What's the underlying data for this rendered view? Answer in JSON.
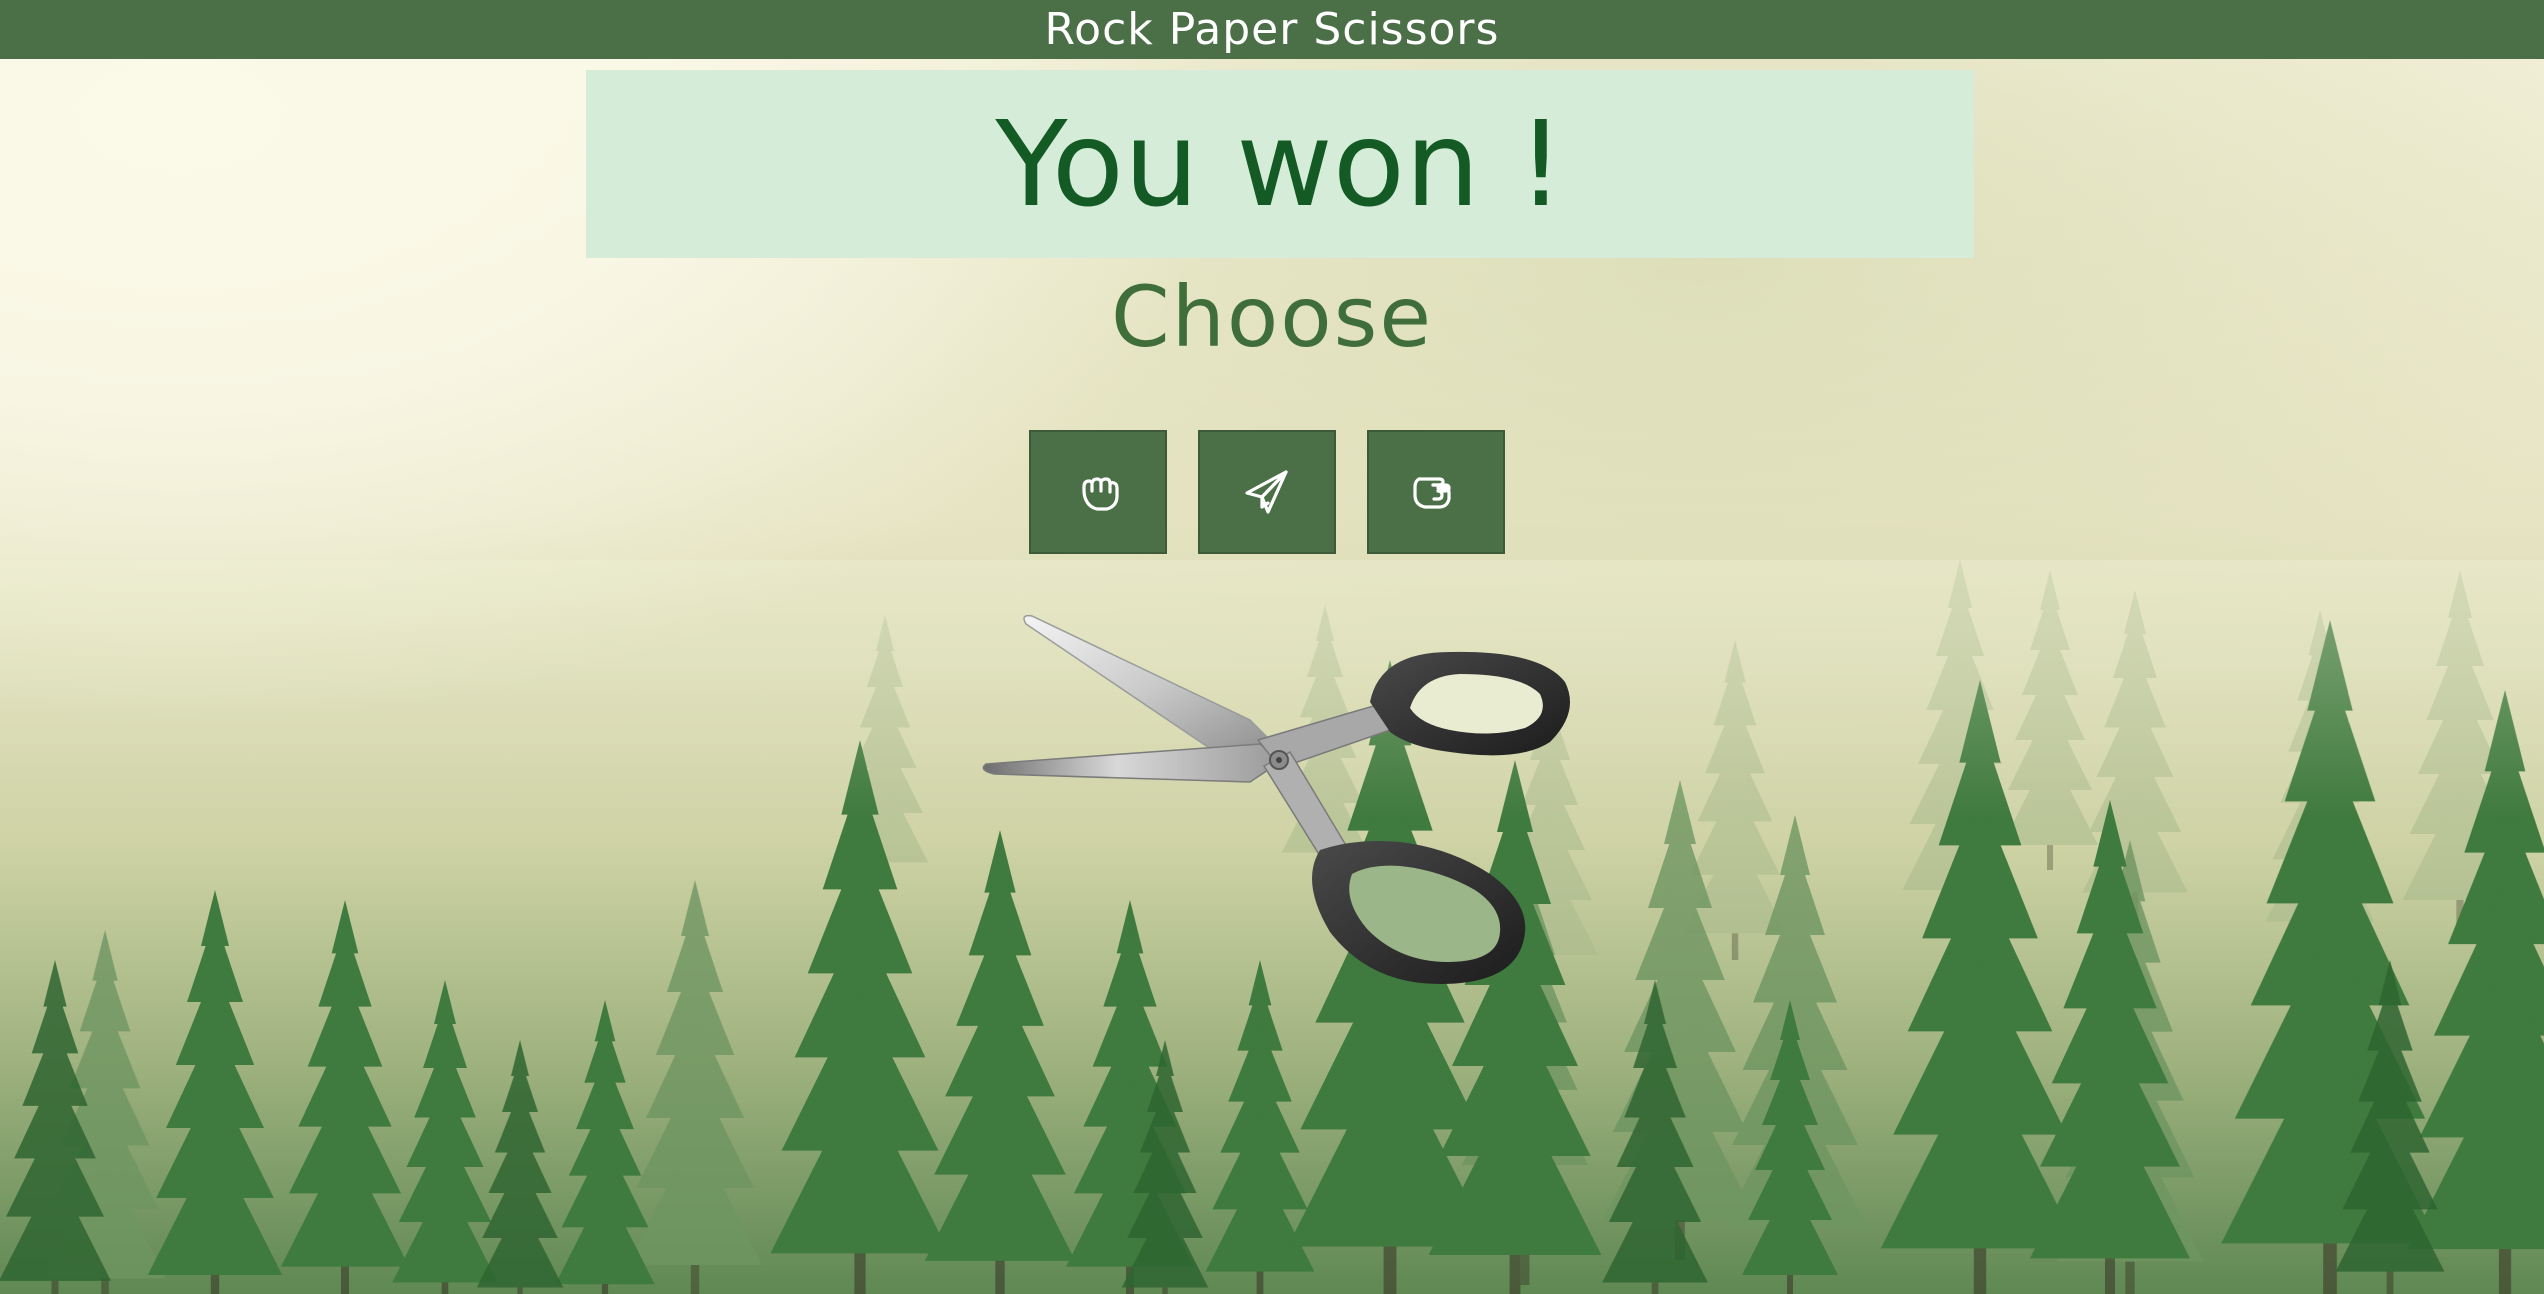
{
  "header": {
    "title": "Rock Paper Scissors"
  },
  "result": {
    "text": "You won !"
  },
  "choose": {
    "label": "Choose"
  },
  "choices": [
    {
      "name": "rock",
      "icon": "hand-fist-icon"
    },
    {
      "name": "paper",
      "icon": "paper-plane-icon"
    },
    {
      "name": "scissors",
      "icon": "hand-scissors-icon"
    }
  ],
  "computer_choice": {
    "icon": "scissors-icon"
  },
  "colors": {
    "header_bg": "#4b7047",
    "banner_bg": "#d4ecd8",
    "result_text": "#145a25",
    "choose_text": "#3f6e3a",
    "button_bg": "#4b7047"
  }
}
